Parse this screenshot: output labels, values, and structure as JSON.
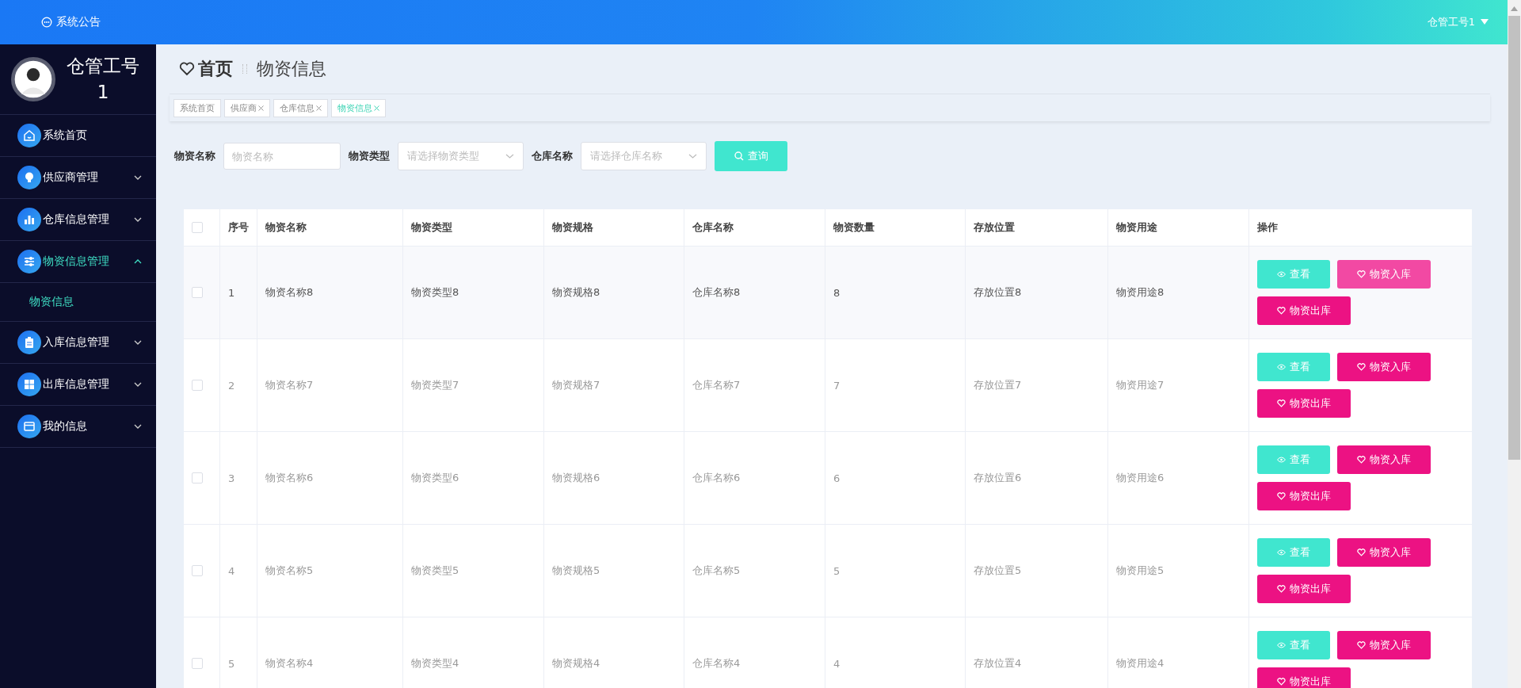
{
  "topbar": {
    "notice": "系统公告",
    "user": "仓管工号1"
  },
  "sidebar": {
    "profile_name": "仓管工号1",
    "items": [
      {
        "label": "系统首页",
        "has_children": false,
        "selected": false
      },
      {
        "label": "供应商管理",
        "expanded": false,
        "has_children": true,
        "selected": false
      },
      {
        "label": "仓库信息管理",
        "expanded": false,
        "has_children": true,
        "selected": false
      },
      {
        "label": "物资信息管理",
        "expanded": true,
        "has_children": true,
        "selected": true,
        "children": [
          {
            "label": "物资信息",
            "selected": true
          }
        ]
      },
      {
        "label": "入库信息管理",
        "expanded": false,
        "has_children": true,
        "selected": false
      },
      {
        "label": "出库信息管理",
        "expanded": false,
        "has_children": true,
        "selected": false
      },
      {
        "label": "我的信息",
        "expanded": false,
        "has_children": true,
        "selected": false
      }
    ]
  },
  "breadcrumb": {
    "home": "首页",
    "current": "物资信息"
  },
  "tabs": [
    {
      "label": "系统首页",
      "closable": false,
      "selected": false
    },
    {
      "label": "供应商",
      "closable": true,
      "selected": false
    },
    {
      "label": "仓库信息",
      "closable": true,
      "selected": false
    },
    {
      "label": "物资信息",
      "closable": true,
      "selected": true
    }
  ],
  "filters": [
    {
      "label": "物资名称",
      "kind": "input",
      "placeholder": "物资名称"
    },
    {
      "label": "物资类型",
      "kind": "select",
      "placeholder": "请选择物资类型"
    },
    {
      "label": "仓库名称",
      "kind": "select",
      "placeholder": "请选择仓库名称"
    }
  ],
  "search_button": "查询",
  "table": {
    "all_checked": false,
    "columns": [
      "序号",
      "物资名称",
      "物资类型",
      "物资规格",
      "仓库名称",
      "物资数量",
      "存放位置",
      "物资用途",
      "操作"
    ],
    "rows": [
      {
        "checked": false,
        "cells": [
          "1",
          "物资名称8",
          "物资类型8",
          "物资规格8",
          "仓库名称8",
          "8",
          "存放位置8",
          "物资用途8"
        ],
        "highlighted": true,
        "actions": [
          "查看",
          "物资入库",
          "物资出库"
        ]
      },
      {
        "checked": false,
        "cells": [
          "2",
          "物资名称7",
          "物资类型7",
          "物资规格7",
          "仓库名称7",
          "7",
          "存放位置7",
          "物资用途7"
        ],
        "highlighted": false,
        "actions": [
          "查看",
          "物资入库",
          "物资出库"
        ]
      },
      {
        "checked": false,
        "cells": [
          "3",
          "物资名称6",
          "物资类型6",
          "物资规格6",
          "仓库名称6",
          "6",
          "存放位置6",
          "物资用途6"
        ],
        "highlighted": false,
        "actions": [
          "查看",
          "物资入库",
          "物资出库"
        ]
      },
      {
        "checked": false,
        "cells": [
          "4",
          "物资名称5",
          "物资类型5",
          "物资规格5",
          "仓库名称5",
          "5",
          "存放位置5",
          "物资用途5"
        ],
        "highlighted": false,
        "actions": [
          "查看",
          "物资入库",
          "物资出库"
        ]
      },
      {
        "checked": false,
        "cells": [
          "5",
          "物资名称4",
          "物资类型4",
          "物资规格4",
          "仓库名称4",
          "4",
          "存放位置4",
          "物资用途4"
        ],
        "highlighted": false,
        "actions": [
          "查看",
          "物资入库",
          "物资出库"
        ]
      }
    ]
  }
}
